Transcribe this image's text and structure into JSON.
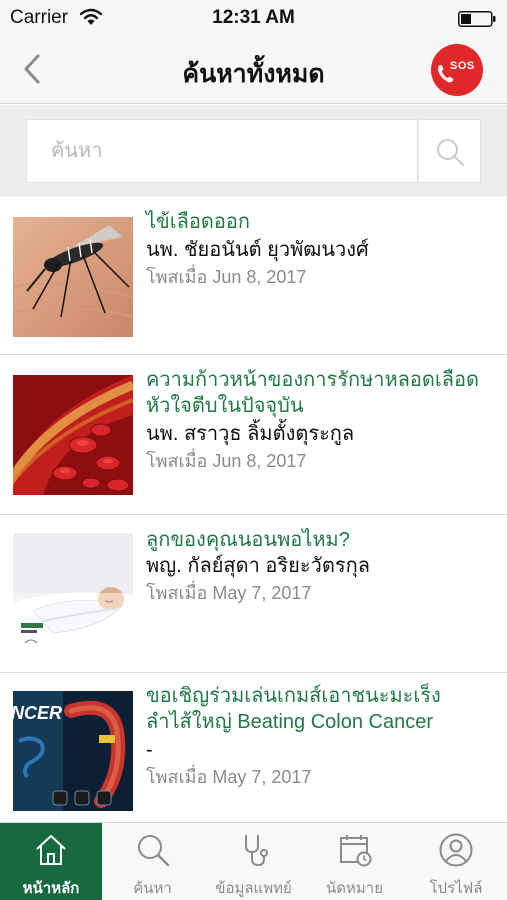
{
  "status_bar": {
    "carrier": "Carrier",
    "time": "12:31 AM"
  },
  "nav": {
    "title": "ค้นหาทั้งหมด",
    "sos_label": "SOS"
  },
  "search": {
    "placeholder": "ค้นหา",
    "value": ""
  },
  "articles": [
    {
      "title_lines": [
        "ไข้เลือดออก"
      ],
      "author": "นพ. ชัยอนันต์ ยุวพัฒนวงศ์",
      "date": "โพสเมื่อ Jun 8, 2017",
      "thumb": "mosquito"
    },
    {
      "title_lines": [
        "ความก้าวหน้าของการรักษาหลอดเลือด",
        "หัวใจตีบในปัจจุบัน"
      ],
      "author": "นพ. สราวุธ ลิ้มตั้งตุระกูล",
      "date": "โพสเมื่อ Jun 8, 2017",
      "thumb": "blood-vessel"
    },
    {
      "title_lines": [
        "ลูกของคุณนอนพอไหม?"
      ],
      "author": "พญ. กัลย์สุดา อริยะวัตรกุล",
      "date": "โพสเมื่อ May 7, 2017",
      "thumb": "sleeping-child"
    },
    {
      "title_lines": [
        "ขอเชิญร่วมเล่นเกมส์เอาชนะมะเร็ง",
        "ลำไส้ใหญ่ Beating Colon Cancer"
      ],
      "author": "-",
      "date": "โพสเมื่อ May 7, 2017",
      "thumb": "colon-cancer-game"
    }
  ],
  "thumb_text": {
    "cancer": "NCER"
  },
  "tabs": [
    {
      "label": "หน้าหลัก",
      "icon": "home-icon",
      "active": true
    },
    {
      "label": "ค้นหา",
      "icon": "search-icon",
      "active": false
    },
    {
      "label": "ข้อมูลแพทย์",
      "icon": "stethoscope-icon",
      "active": false
    },
    {
      "label": "นัดหมาย",
      "icon": "calendar-icon",
      "active": false
    },
    {
      "label": "โปรไฟล์",
      "icon": "profile-icon",
      "active": false
    }
  ],
  "colors": {
    "accent_green": "#1f7a45",
    "tab_active_bg": "#176a3f",
    "sos_red": "#e0282b"
  }
}
